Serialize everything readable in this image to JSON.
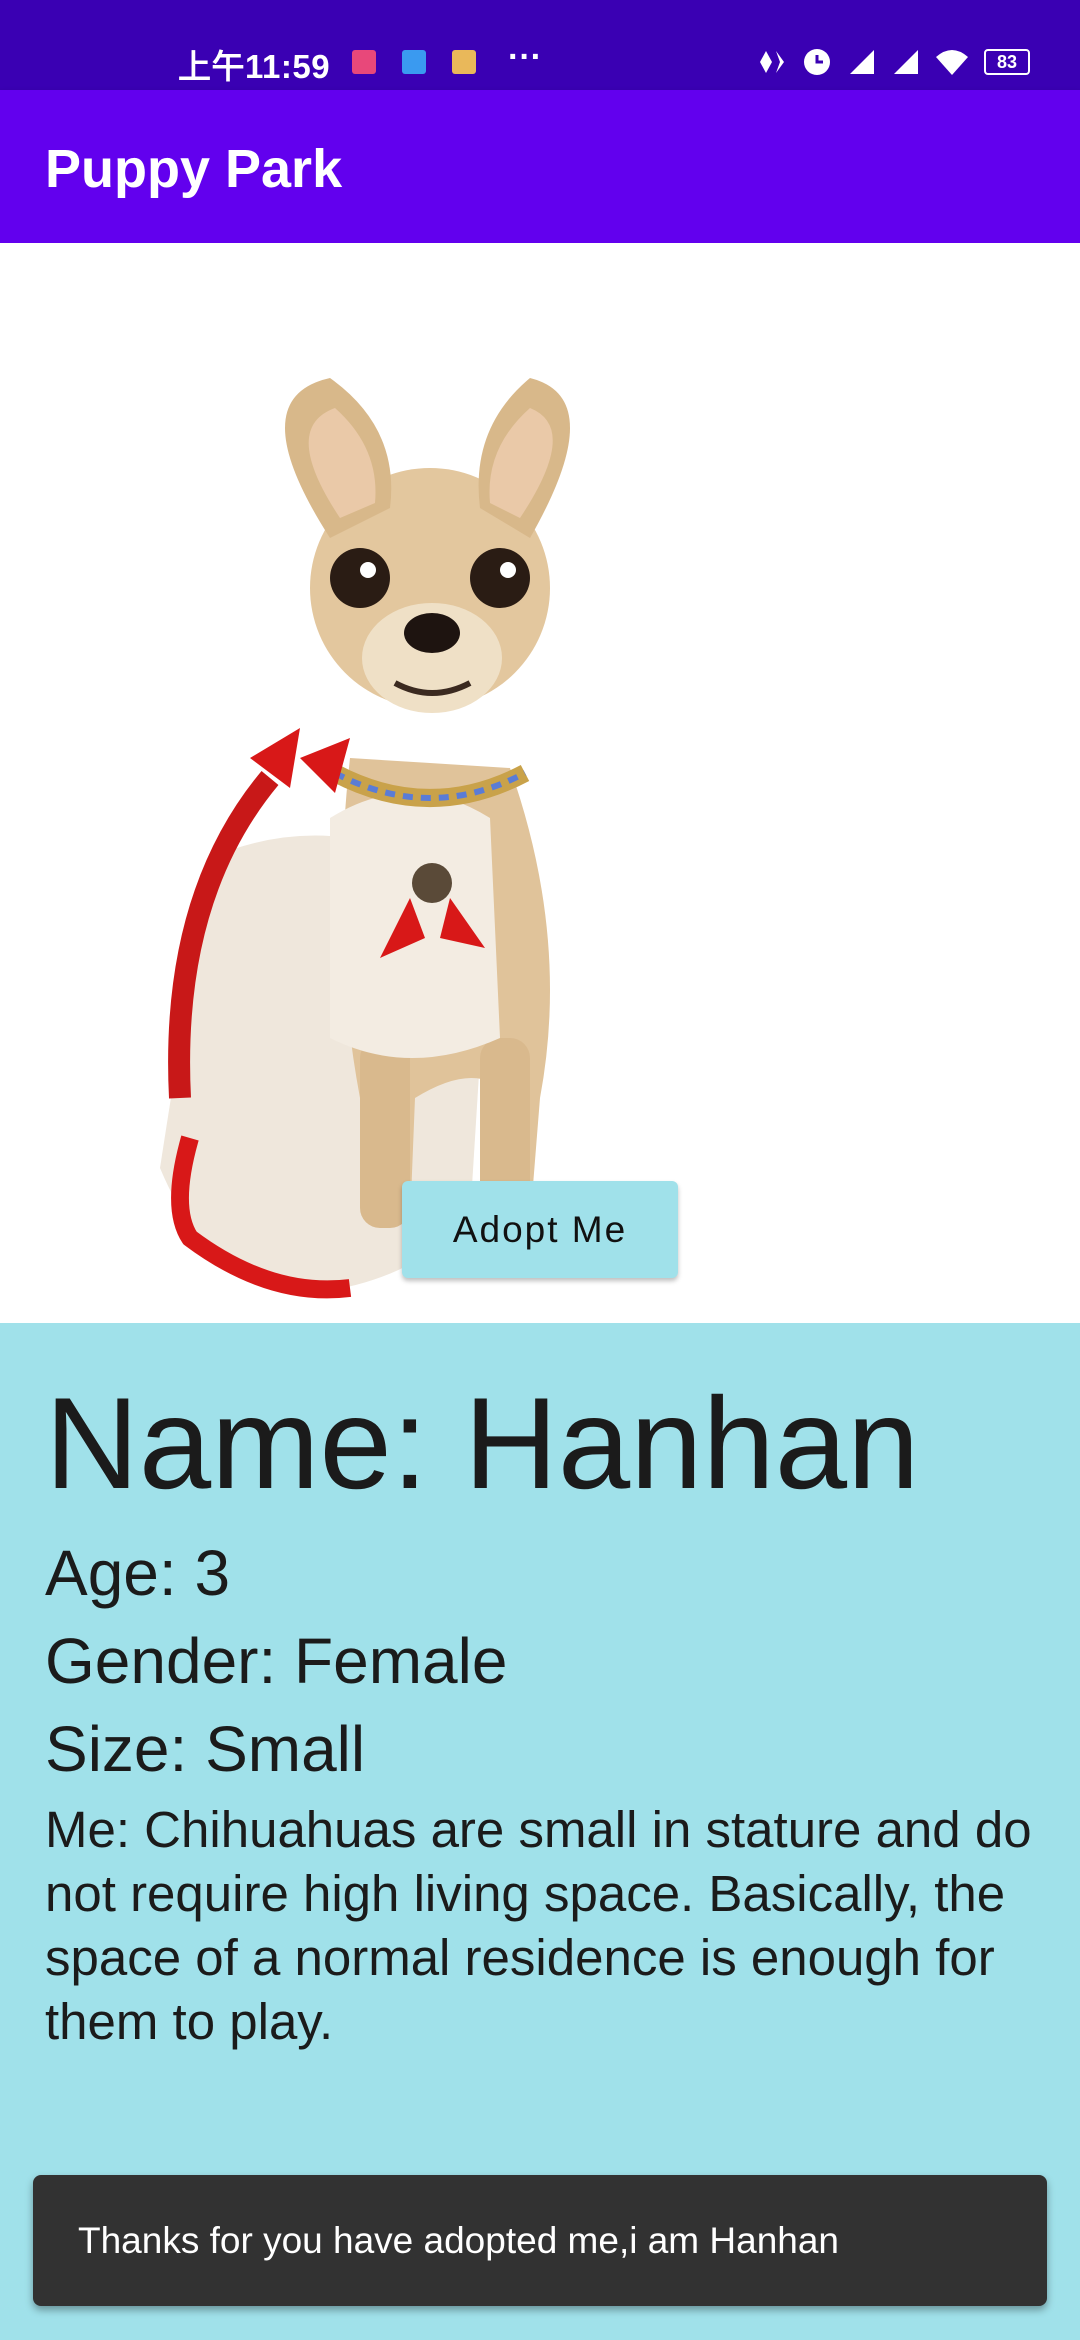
{
  "status_bar": {
    "time": "上午11:59",
    "more": "···",
    "battery": "83",
    "notification_icons": [
      "app-icon-pink",
      "app-icon-blue",
      "app-icon-yellow"
    ],
    "system_icons": [
      "nfc-icon",
      "alarm-icon",
      "signal-icon",
      "signal-icon",
      "wifi-icon",
      "battery-icon"
    ]
  },
  "app_bar": {
    "title": "Puppy Park"
  },
  "hero": {
    "image": "chihuahua-photo"
  },
  "adopt_button": {
    "label": "Adopt Me"
  },
  "details": {
    "name": "Name: Hanhan",
    "age": "Age: 3",
    "gender": "Gender: Female",
    "size": "Size: Small",
    "description": "Me: Chihuahuas are small in stature and do not require high living space. Basically, the space of a normal residence is enough for them to play."
  },
  "snackbar": {
    "message": "Thanks for you have adopted me,i am Hanhan"
  },
  "colors": {
    "status_bar": "#3a00b3",
    "app_bar": "#6200ee",
    "accent": "#a0e1ea",
    "snackbar": "#323232"
  }
}
